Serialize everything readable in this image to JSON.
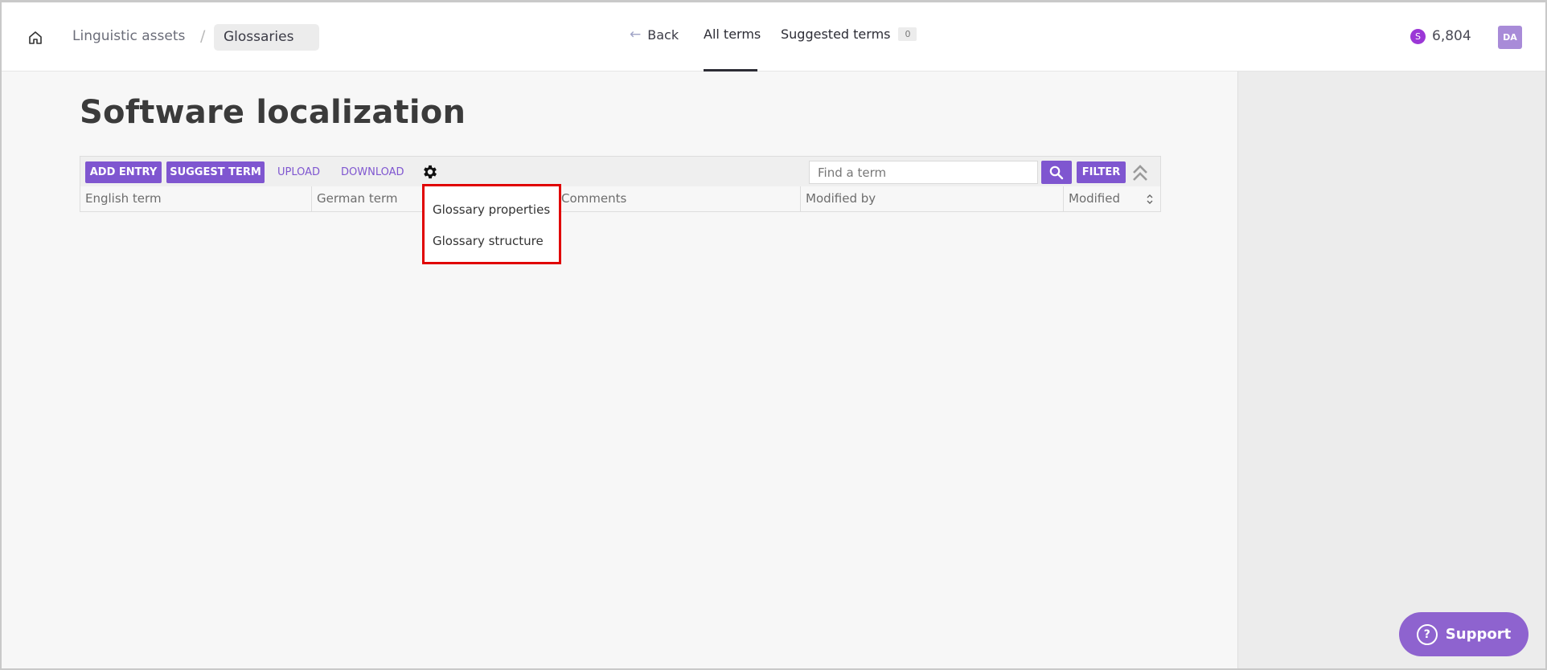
{
  "breadcrumb": {
    "home_icon": "home-icon",
    "linguistic_assets": "Linguistic assets",
    "separator": "/",
    "current": "Glossaries"
  },
  "nav": {
    "back": "Back",
    "back_icon": "arrow-left-icon",
    "tabs": [
      {
        "label": "All terms",
        "active": true
      },
      {
        "label": "Suggested terms",
        "count": "0",
        "active": false
      }
    ]
  },
  "user": {
    "credits_icon": "S",
    "credits": "6,804",
    "avatar_initials": "DA"
  },
  "page": {
    "title": "Software localization"
  },
  "toolbar": {
    "add_entry": "ADD ENTRY",
    "suggest_term": "SUGGEST TERM",
    "upload": "UPLOAD",
    "download": "DOWNLOAD",
    "settings_icon": "gear-icon",
    "search_placeholder": "Find a term",
    "search_icon": "search-icon",
    "filter": "FILTER",
    "collapse_icon": "double-chevron-up-icon"
  },
  "table": {
    "columns": [
      "English term",
      "German term",
      "Comments",
      "Modified by",
      "Modified"
    ]
  },
  "settings_menu": {
    "items": [
      "Glossary properties",
      "Glossary structure"
    ]
  },
  "support": {
    "label": "Support",
    "icon": "?"
  },
  "colors": {
    "accent": "#7f56d0",
    "support": "#8e63cf",
    "highlight_border": "#e00000"
  }
}
